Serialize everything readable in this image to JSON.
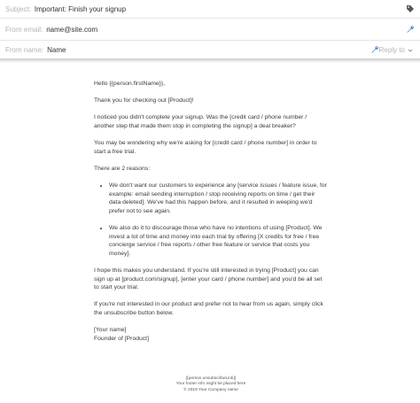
{
  "header": {
    "subject_label": "Subject:",
    "subject_value": "Important: Finish your signup",
    "from_email_label": "From email:",
    "from_email_value": "name@site.com",
    "from_name_label": "From name:",
    "from_name_value": "Name",
    "reply_to_label": "Reply to",
    "icons": [
      "tag-icon",
      "wrench-icon",
      "wrench-icon",
      "chevron-down-icon"
    ]
  },
  "email": {
    "greeting": "Hello {{person.firstName}},",
    "thanks": "Thank you for checking out [Product]!",
    "p1": "I noticed you didn't complete your signup. Was the [credit card / phone number / another step that made them stop in completing the signup] a deal breaker?",
    "p2": "You may be wondering why we're asking for [credit card / phone number] in order to start a free trial.",
    "reasons_intro": "There are 2 reasons:",
    "reasons": [
      "We don't want our customers to experience any [service issues / feature issue, for example: email sending interruption / stop receiving reports on time / get their data deleted]. We've had this happen before, and it resulted in weeping we'd prefer not to see again.",
      "We also do it to discourage those who have no intentions of using [Product]. We invest a lot of time and money into each trial by offering [X credits for free / free concierge service / free reports / other free feature or service that costs you money]."
    ],
    "p3": "I hope this makes you understand. If you're still interested in trying [Product] you can sign up at [product.com/signup], [enter your card / phone number] and you'd be all set to start your trial.",
    "p4": "If you're not interested in our product and prefer not to hear from us again, simply click the unsubscribe button below.",
    "sig_name": "[Your name]",
    "sig_title": "Founder of [Product]"
  },
  "footer": {
    "unsubscribe": "{{person.unsubscribeLink}}",
    "info": "Your footer info might be placed here",
    "copyright": "© 2019 Your Company name"
  },
  "colors": {
    "label": "#b5b5b5",
    "icon": "#4a7fd6",
    "text": "#3a3a3a"
  }
}
